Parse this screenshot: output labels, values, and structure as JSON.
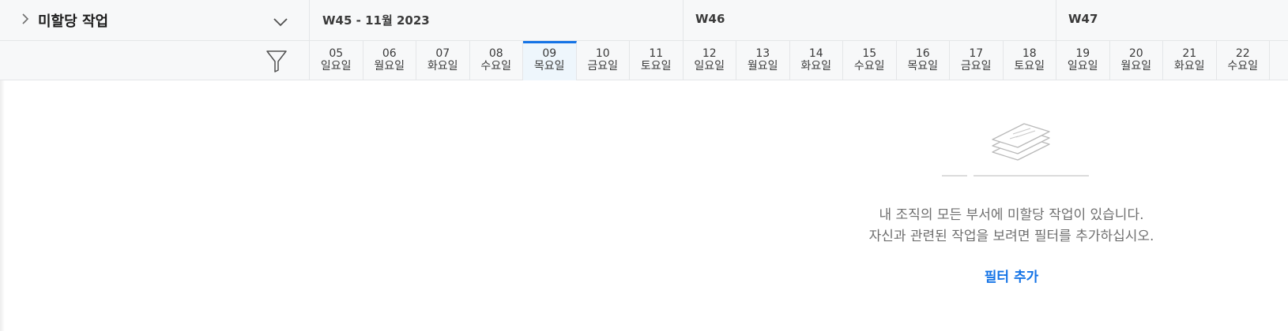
{
  "panel": {
    "title": "미할당 작업",
    "expand_icon": "chevron-right-icon",
    "collapse_icon": "chevron-down-icon",
    "filter_icon": "funnel-icon"
  },
  "weeks": [
    {
      "label": "W45 - 11월 2023"
    },
    {
      "label": "W46"
    },
    {
      "label": "W47"
    }
  ],
  "days": [
    {
      "num": "05",
      "name": "일요일"
    },
    {
      "num": "06",
      "name": "월요일"
    },
    {
      "num": "07",
      "name": "화요일"
    },
    {
      "num": "08",
      "name": "수요일"
    },
    {
      "num": "09",
      "name": "목요일",
      "today": true
    },
    {
      "num": "10",
      "name": "금요일"
    },
    {
      "num": "11",
      "name": "토요일"
    },
    {
      "num": "12",
      "name": "일요일"
    },
    {
      "num": "13",
      "name": "월요일"
    },
    {
      "num": "14",
      "name": "화요일"
    },
    {
      "num": "15",
      "name": "수요일"
    },
    {
      "num": "16",
      "name": "목요일"
    },
    {
      "num": "17",
      "name": "금요일"
    },
    {
      "num": "18",
      "name": "토요일"
    },
    {
      "num": "19",
      "name": "일요일"
    },
    {
      "num": "20",
      "name": "월요일"
    },
    {
      "num": "21",
      "name": "화요일"
    },
    {
      "num": "22",
      "name": "수요일"
    }
  ],
  "empty_state": {
    "line1": "내 조직의 모든 부서에 미할당 작업이 있습니다.",
    "line2": "자신과 관련된 작업을 보려면 필터를 추가하십시오.",
    "action": "필터 추가",
    "illustration_icon": "stacked-papers-icon"
  },
  "colors": {
    "accent": "#1473e6",
    "header_bg": "#f7f8f9",
    "today_bg": "#eef6fc"
  }
}
